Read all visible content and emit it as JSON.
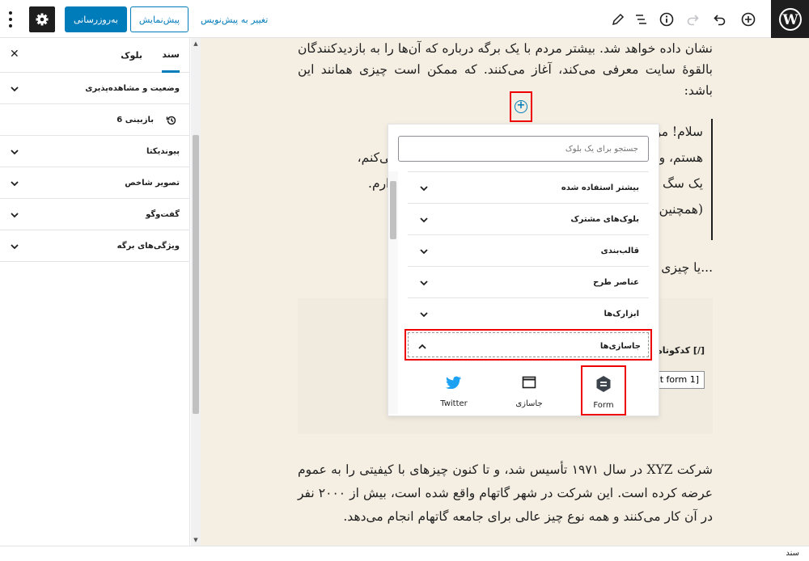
{
  "toolbar": {
    "update_label": "به‌روزرسانی",
    "preview_label": "پیش‌نمایش",
    "switch_draft_label": "تغییر به پیش‌نویس"
  },
  "sidebar": {
    "tab_document": "سند",
    "tab_block": "بلوک",
    "panels": [
      {
        "title": "وضعیت و مشاهده‌پذیری"
      },
      {
        "title": "پیوندیکتا"
      },
      {
        "title": "تصویر شاخص"
      },
      {
        "title": "گفت‌وگو"
      },
      {
        "title": "ویژگی‌های برگه"
      }
    ],
    "revisions_label": "6 بازبینی"
  },
  "editor": {
    "p1": "نشان داده خواهد شد. بیشتر مردم با یک برگه درباره که آن‌ها را به بازدیدکنندگان بالقوهٔ سایت معرفی می‌کند، آغاز می‌کنند. که ممکن است چیزی همانند این باشد:",
    "quote_lines": [
      "سلام! من پیشخدمت روزها هستم، مشتاق بازیگری و در شب",
      "هستم، و این وب‌سایت من است. من در لس‌آنجلس زندگی می‌کنم،",
      "یک سگ بزرگ به نام جک دارم، و نوشیدنی پیناکولادا دوست دارم.",
      "(همچنین در باران)"
    ],
    "p3": "...یا چیزی همانند این:",
    "shortcode_label": "[/] کدکوتاه",
    "shortcode_value": "[contact form 1]",
    "p4": "شرکت XYZ در سال ۱۹۷۱ تأسیس شد، و تا کنون چیزهای با کیفیتی را به عموم عرضه کرده است. این شرکت در شهر گاتهام واقع شده است، بیش از ۲۰۰۰ نفر در آن کار می‌کنند و همه نوع چیز عالی برای جامعه گاتهام انجام می‌دهد."
  },
  "inserter": {
    "search_placeholder": "جستجو برای یک بلوک",
    "categories": [
      {
        "title": "بیشتر استفاده شده"
      },
      {
        "title": "بلوک‌های مشترک"
      },
      {
        "title": "قالب‌بندی"
      },
      {
        "title": "عناصر طرح"
      },
      {
        "title": "ابزارک‌ها"
      },
      {
        "title": "جاسازی‌ها"
      }
    ],
    "items": [
      {
        "label": "Form"
      },
      {
        "label": "جاسازی"
      },
      {
        "label": "Twitter"
      }
    ]
  },
  "statusbar": {
    "text": "سند"
  },
  "colors": {
    "primary": "#007cba",
    "highlight": "#ee0000",
    "editor_bg": "#f5efe3",
    "dark": "#1e1e1e"
  }
}
